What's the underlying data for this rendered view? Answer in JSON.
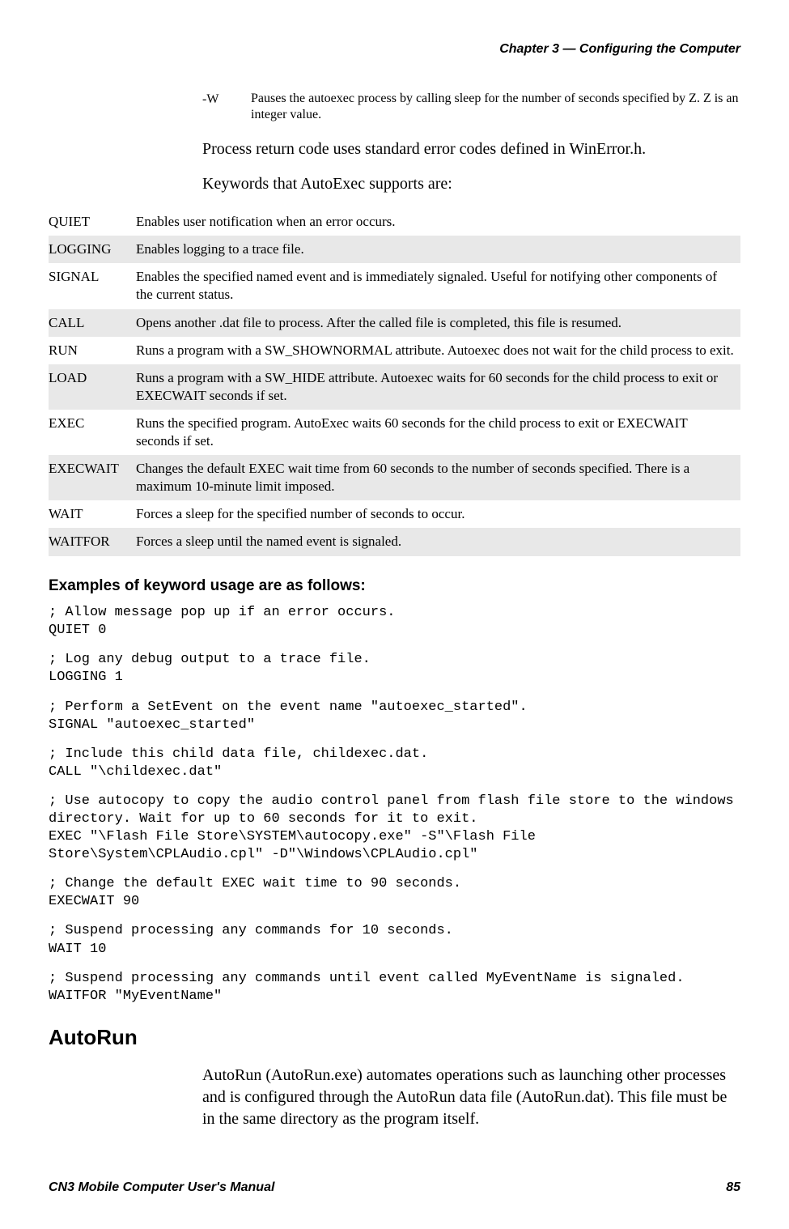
{
  "header": {
    "chapter_line": "Chapter 3 —  Configuring the Computer"
  },
  "option": {
    "key": "-W",
    "desc": "Pauses the autoexec process by calling sleep for the number of seconds specified by Z. Z is an integer value."
  },
  "paragraphs": {
    "p1": "Process return code uses standard error codes defined in WinError.h.",
    "p2": "Keywords that AutoExec supports are:"
  },
  "keywords_table": [
    {
      "kw": "QUIET",
      "desc": "Enables user notification when an error occurs."
    },
    {
      "kw": "LOGGING",
      "desc": "Enables logging to a trace file."
    },
    {
      "kw": "SIGNAL",
      "desc": "Enables the specified named event and is immediately signaled. Useful for notifying other components of the current status."
    },
    {
      "kw": "CALL",
      "desc": "Opens another .dat file to process. After the called file is completed, this file is resumed."
    },
    {
      "kw": "RUN",
      "desc": "Runs a program with a SW_SHOWNORMAL attribute. Autoexec does not wait for the child process to exit."
    },
    {
      "kw": "LOAD",
      "desc": "Runs a program with a SW_HIDE attribute. Autoexec waits for 60 seconds for the child process to exit or EXECWAIT seconds if set."
    },
    {
      "kw": "EXEC",
      "desc": "Runs the specified program. AutoExec waits 60 seconds for the child process to exit or EXECWAIT seconds if set."
    },
    {
      "kw": "EXECWAIT",
      "desc": "Changes the default EXEC wait time from 60 seconds to the number of seconds specified. There is a maximum 10-minute limit imposed."
    },
    {
      "kw": "WAIT",
      "desc": "Forces a sleep for the specified number of seconds to occur."
    },
    {
      "kw": "WAITFOR",
      "desc": "Forces a sleep until the named event is signaled."
    }
  ],
  "examples": {
    "heading": "Examples of keyword usage are as follows:",
    "blocks": [
      "; Allow message pop up if an error occurs.\nQUIET 0",
      "; Log any debug output to a trace file.\nLOGGING 1",
      "; Perform a SetEvent on the event name \"autoexec_started\".\nSIGNAL \"autoexec_started\"",
      "; Include this child data file, childexec.dat.\nCALL \"\\childexec.dat\"",
      "; Use autocopy to copy the audio control panel from flash file store to the windows directory. Wait for up to 60 seconds for it to exit.\nEXEC \"\\Flash File Store\\SYSTEM\\autocopy.exe\" -S\"\\Flash File Store\\System\\CPLAudio.cpl\" -D\"\\Windows\\CPLAudio.cpl\"",
      "; Change the default EXEC wait time to 90 seconds.\nEXECWAIT 90",
      "; Suspend processing any commands for 10 seconds.\nWAIT 10",
      "; Suspend processing any commands until event called MyEventName is signaled.\nWAITFOR \"MyEventName\""
    ]
  },
  "autorun": {
    "heading": "AutoRun",
    "body": "AutoRun (AutoRun.exe) automates operations such as launching other processes and is configured through the AutoRun data file (AutoRun.dat). This file must be in the same directory as the program itself."
  },
  "footer": {
    "left": "CN3 Mobile Computer User's Manual",
    "right": "85"
  }
}
